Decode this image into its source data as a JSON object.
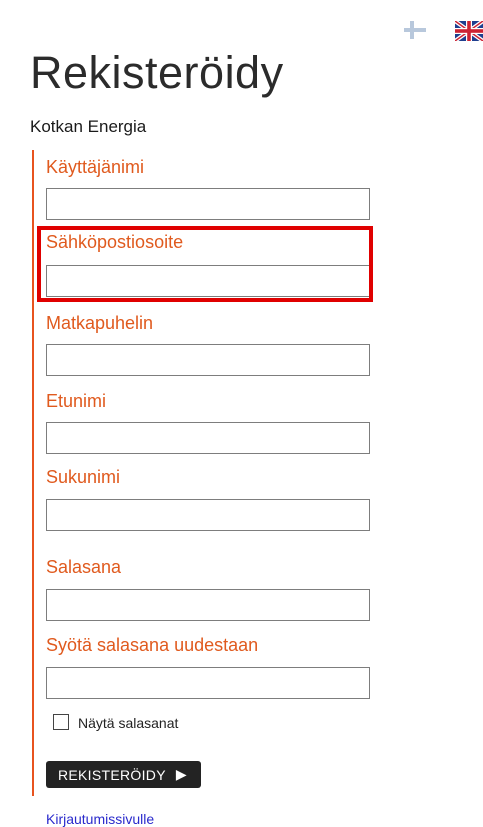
{
  "language": {
    "options": [
      {
        "name": "fi-flag-icon",
        "code": "FI"
      },
      {
        "name": "uk-flag-icon",
        "code": "EN"
      }
    ]
  },
  "header": {
    "title": "Rekisteröidy",
    "subtitle": "Kotkan Energia"
  },
  "form": {
    "fields": [
      {
        "label": "Käyttäjänimi",
        "value": ""
      },
      {
        "label": "Sähköpostiosoite",
        "value": ""
      },
      {
        "label": "Matkapuhelin",
        "value": ""
      },
      {
        "label": "Etunimi",
        "value": ""
      },
      {
        "label": "Sukunimi",
        "value": ""
      },
      {
        "label": "Salasana",
        "value": ""
      },
      {
        "label": "Syötä salasana uudestaan",
        "value": ""
      }
    ],
    "show_passwords_label": "Näytä salasanat",
    "show_passwords_checked": false,
    "submit_label": "REKISTERÖIDY"
  },
  "footer": {
    "login_link": "Kirjautumissivulle"
  },
  "colors": {
    "accent": "#e05a1e",
    "highlight": "#e00000",
    "button_bg": "#232323"
  }
}
